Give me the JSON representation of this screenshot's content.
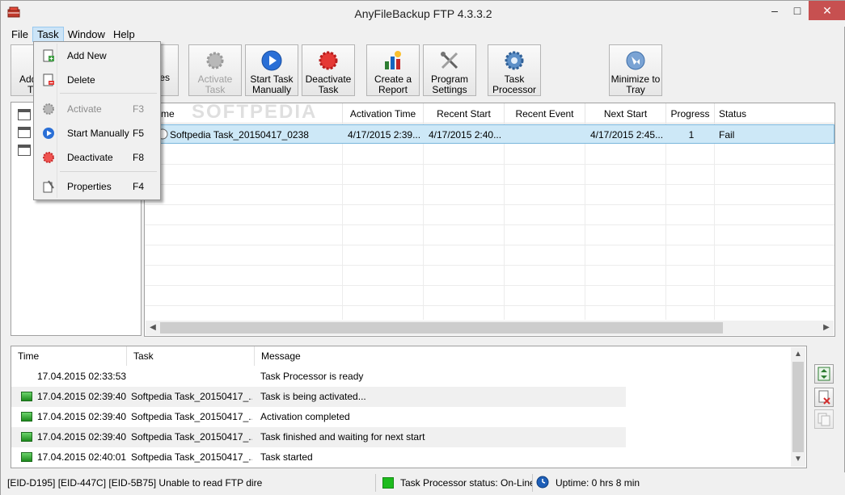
{
  "window": {
    "title": "AnyFileBackup FTP 4.3.3.2",
    "minimize": "–",
    "maximize": "□",
    "close": "✕"
  },
  "menu": {
    "file": "File",
    "task": "Task",
    "window": "Window",
    "help": "Help"
  },
  "task_menu": {
    "add_new": "Add New",
    "delete": "Delete",
    "activate": "Activate",
    "activate_key": "F3",
    "start_manually": "Start Manually",
    "start_manually_key": "F5",
    "deactivate": "Deactivate",
    "deactivate_key": "F8",
    "properties": "Properties",
    "properties_key": "F4"
  },
  "toolbar": {
    "add_partial": "Add",
    "add_partial2": "T",
    "properties_partial": "es",
    "activate": "Activate\nTask",
    "start_manually": "Start Task\nManually",
    "deactivate": "Deactivate\nTask",
    "create_report": "Create a\nReport",
    "program_settings": "Program\nSettings",
    "task_processor": "Task\nProcessor",
    "minimize_tray": "Minimize to\nTray"
  },
  "task_grid": {
    "columns": [
      "me",
      "Activation Time",
      "Recent Start",
      "Recent Event",
      "Next Start",
      "Progress",
      "Status"
    ],
    "rows": [
      {
        "name": "Softpedia Task_20150417_0238",
        "activation_time": "4/17/2015 2:39...",
        "recent_start": "4/17/2015 2:40...",
        "recent_event": "",
        "next_start": "4/17/2015 2:45...",
        "progress": "1",
        "status": "Fail"
      }
    ]
  },
  "log": {
    "columns": [
      "Time",
      "Task",
      "Message"
    ],
    "rows": [
      {
        "time": "17.04.2015  02:33:53",
        "task": "",
        "message": "Task Processor is ready",
        "icon": false
      },
      {
        "time": "17.04.2015  02:39:40",
        "task": "Softpedia Task_20150417_...",
        "message": "Task is being activated...",
        "icon": true
      },
      {
        "time": "17.04.2015  02:39:40",
        "task": "Softpedia Task_20150417_...",
        "message": "Activation completed",
        "icon": true
      },
      {
        "time": "17.04.2015  02:39:40",
        "task": "Softpedia Task_20150417_...",
        "message": "Task finished and waiting for next start",
        "icon": true
      },
      {
        "time": "17.04.2015  02:40:01",
        "task": "Softpedia Task_20150417_...",
        "message": "Task started",
        "icon": true
      }
    ]
  },
  "status": {
    "error": "[EID-D195] [EID-447C] [EID-5B75] Unable to read FTP dire",
    "processor": "Task Processor status:  On-Line",
    "uptime": "Uptime: 0 hrs 8 min"
  },
  "watermark": "SOFTPEDIA",
  "colors": {
    "selection": "#cde8f7",
    "selection_border": "#7ab6dc",
    "menu_highlight": "#cce4f7",
    "status_green": "#1dbb1d"
  }
}
